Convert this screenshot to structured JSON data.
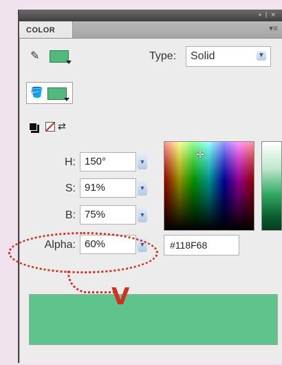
{
  "panel": {
    "tab_label": "COLOR",
    "window_controls": "« | ×",
    "menu_icon": "panel-menu-icon"
  },
  "stroke": {
    "color": "#51b87e"
  },
  "fill": {
    "color": "#51b87e"
  },
  "type": {
    "label": "Type:",
    "value": "Solid"
  },
  "hsb": {
    "h_label": "H:",
    "h_value": "150°",
    "s_label": "S:",
    "s_value": "91%",
    "b_label": "B:",
    "b_value": "75%"
  },
  "alpha": {
    "label": "Alpha:",
    "value": "60%"
  },
  "hex": {
    "value": "#118F68"
  },
  "preview": {
    "color": "#5fc48b"
  },
  "annotation": {
    "marker": "V",
    "color": "#d23020"
  }
}
